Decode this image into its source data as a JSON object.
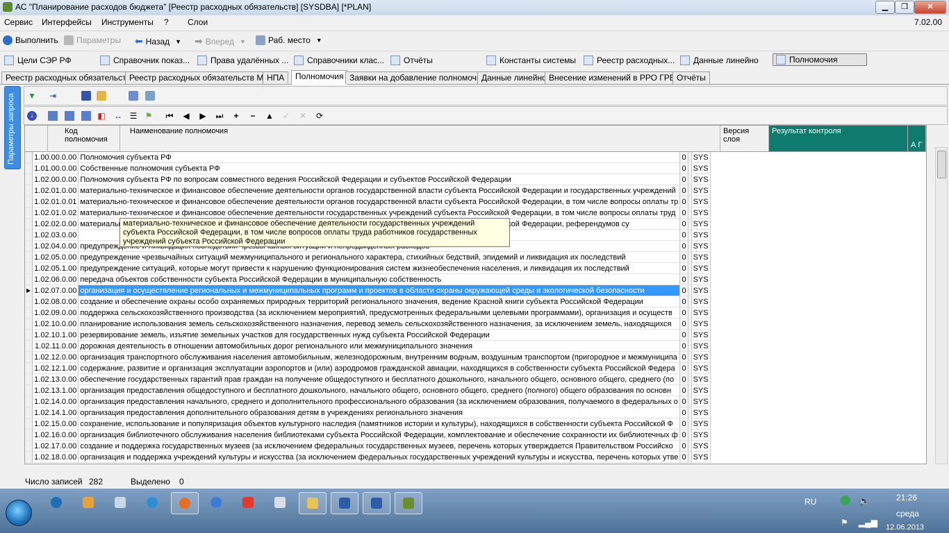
{
  "window": {
    "title": "АС \"Планирование расходов бюджета\" [Реестр расходных обязательств] [SYSDBA] [*PLAN]",
    "version": "7.02.00"
  },
  "menu": [
    "Сервис",
    "Интерфейсы",
    "Инструменты",
    "?",
    "Слои"
  ],
  "toolbar": {
    "run": "Выполнить",
    "params": "Параметры",
    "back": "Назад",
    "forward": "Вперед",
    "workspace": "Раб. место"
  },
  "quicklinks": [
    "Цели СЭР РФ",
    "Справочник показ...",
    "Права удалённых ...",
    "Справочники клас...",
    "Отчёты",
    "Константы системы",
    "Реестр расходных...",
    "Данные линейно",
    "Полномочия"
  ],
  "tabs": [
    "Реестр расходных обязательств",
    "Реестр расходных обязательств МО",
    "НПА",
    "Полномочия",
    "Заявки на добавление полномочий",
    "Данные линейно",
    "Внесение изменений в РРО ГРБС",
    "Отчёты"
  ],
  "side_panel": "Параметры запроса",
  "grid": {
    "headers": {
      "code": "Код полномочия",
      "name": "Наименование полномочия",
      "version": "Версия слоя",
      "result": "Результат контроля",
      "extra": "А Г"
    },
    "rows": [
      {
        "code": "1.00.00.0.00",
        "name": "Полномочия субъекта РФ",
        "version": "0",
        "extra": "SYS"
      },
      {
        "code": "1.01.00.0.00",
        "name": "Собственные полномочия субъекта РФ",
        "version": "0",
        "extra": "SYS"
      },
      {
        "code": "1.02.00.0.00",
        "name": "Полномочия субъекта РФ по вопросам совместного ведения Российской Федерации и субъектов Российской Федерации",
        "version": "0",
        "extra": "SYS"
      },
      {
        "code": "1.02.01.0.00",
        "name": "материально-техническое и финансовое обеспечение деятельности органов государственной власти субъекта Российской Федерации и государственных учреждений",
        "version": "0",
        "extra": "SYS"
      },
      {
        "code": "1.02.01.0.01",
        "name": "материально-техническое и финансовое обеспечение деятельности органов государственной власти субъекта Российской Федерации, в том числе вопросы оплаты тр",
        "version": "0",
        "extra": "SYS"
      },
      {
        "code": "1.02.01.0.02",
        "name": "материально-техническое и финансовое обеспечение деятельности государственных учреждений субъекта Российской Федерации, в том числе вопросы оплаты труд",
        "version": "0",
        "extra": "SYS"
      },
      {
        "code": "1.02.02.0.00",
        "name": "материально-техническое и финансовое обеспечение деятельности органов государственной власти субъекта Российской Федерации, референдумов су",
        "version": "0",
        "extra": "SYS"
      },
      {
        "code": "1.02.03.0.00",
        "name": "",
        "version": "0",
        "extra": "SYS"
      },
      {
        "code": "1.02.04.0.00",
        "name": "предупреждение и ликвидация последствий чрезвычайных ситуаций и непредвиденных расходов",
        "version": "0",
        "extra": "SYS"
      },
      {
        "code": "1.02.05.0.00",
        "name": "предупреждение чрезвычайных ситуаций межмуниципального и регионального характера, стихийных бедствий, эпидемий и ликвидация их последствий",
        "version": "0",
        "extra": "SYS"
      },
      {
        "code": "1.02.05.1.00",
        "name": "предупреждение ситуаций, которые могут привести к нарушению функционирования систем жизнеобеспечения населения, и ликвидация их последствий",
        "version": "0",
        "extra": "SYS"
      },
      {
        "code": "1.02.06.0.00",
        "name": "передача объектов собственности субъекта Российской Федерации в муниципальную собственность",
        "version": "0",
        "extra": "SYS"
      },
      {
        "code": "1.02.07.0.00",
        "name": "организация и осуществление региональных и межмуниципальных программ и проектов в области охраны окружающей среды и экологической безопасности",
        "version": "0",
        "extra": "SYS",
        "selected": true
      },
      {
        "code": "1.02.08.0.00",
        "name": "создание и обеспечение охраны особо охраняемых природных территорий регионального значения, ведение Красной книги субъекта Российской Федерации",
        "version": "0",
        "extra": "SYS"
      },
      {
        "code": "1.02.09.0.00",
        "name": "поддержка сельскохозяйственного производства (за исключением мероприятий, предусмотренных федеральными целевыми программами), организация и осуществ",
        "version": "0",
        "extra": "SYS"
      },
      {
        "code": "1.02.10.0.00",
        "name": "планирование использования земель сельскохозяйственного назначения, перевод земель сельскохозяйственного назначения, за исключением земель, находящихся",
        "version": "0",
        "extra": "SYS"
      },
      {
        "code": "1.02.10.1.00",
        "name": "резервирование земель, изъятие земельных участков для государственных нужд субъекта Российской Федерации",
        "version": "0",
        "extra": "SYS"
      },
      {
        "code": "1.02.11.0.00",
        "name": "дорожная деятельность в отношении автомобильных дорог регионального или межмуниципального значения",
        "version": "0",
        "extra": "SYS"
      },
      {
        "code": "1.02.12.0.00",
        "name": "организация транспортного обслуживания населения автомобильным, железнодорожным, внутренним водным, воздушным транспортом (пригородное и межмуниципа",
        "version": "0",
        "extra": "SYS"
      },
      {
        "code": "1.02.12.1.00",
        "name": "содержание, развитие и организация эксплуатации аэропортов и (или) аэродромов гражданской авиации, находящихся в собственности субъекта Российской Федера",
        "version": "0",
        "extra": "SYS"
      },
      {
        "code": "1.02.13.0.00",
        "name": "обеспечение государственных гарантий прав граждан на получение общедоступного и бесплатного дошкольного, начального общего, основного общего, среднего (по",
        "version": "0",
        "extra": "SYS"
      },
      {
        "code": "1.02.13.1.00",
        "name": "организация предоставления общедоступного и бесплатного дошкольного, начального общего, основного общего, среднего (полного) общего образования по основн",
        "version": "0",
        "extra": "SYS"
      },
      {
        "code": "1.02.14.0.00",
        "name": "организация предоставления начального, среднего и дополнительного профессионального образования (за исключением образования, получаемого в федеральных о",
        "version": "0",
        "extra": "SYS"
      },
      {
        "code": "1.02.14.1.00",
        "name": "организация предоставления дополнительного образования детям в учреждениях регионального значения",
        "version": "0",
        "extra": "SYS"
      },
      {
        "code": "1.02.15.0.00",
        "name": "сохранение, использование и популяризация объектов культурного наследия (памятников истории и культуры), находящихся в собственности субъекта Российской Ф",
        "version": "0",
        "extra": "SYS"
      },
      {
        "code": "1.02.16.0.00",
        "name": "организация библиотечного обслуживания населения библиотеками субъекта Российской Федерации, комплектование и обеспечение сохранности их библиотечных ф",
        "version": "0",
        "extra": "SYS"
      },
      {
        "code": "1.02.17.0.00",
        "name": "создание и поддержка государственных музеев (за исключением федеральных государственных музеев, перечень которых утверждается Правительством Российско",
        "version": "0",
        "extra": "SYS"
      },
      {
        "code": "1.02.18.0.00",
        "name": "организация и поддержка учреждений культуры и искусства (за исключением федеральных государственных учреждений культуры и искусства, перечень которых утве",
        "version": "0",
        "extra": "SYS"
      }
    ]
  },
  "tooltip": "материально-техническое и финансовое обеспечение деятельности государственных учреждений субъекта Российской Федерации, в том числе вопросов оплаты труда работников государственных учреждений субъекта Российской Федерации",
  "status": {
    "records_label": "Число записей",
    "records_value": "282",
    "selected_label": "Выделено",
    "selected_value": "0"
  },
  "taskbar": {
    "lang": "RU",
    "time": "21:26",
    "day": "среда",
    "date": "12.06.2013"
  },
  "colors": {
    "selection": "#3399ff",
    "result_header": "#0f7a6e",
    "side_panel": "#3d8ee0"
  }
}
